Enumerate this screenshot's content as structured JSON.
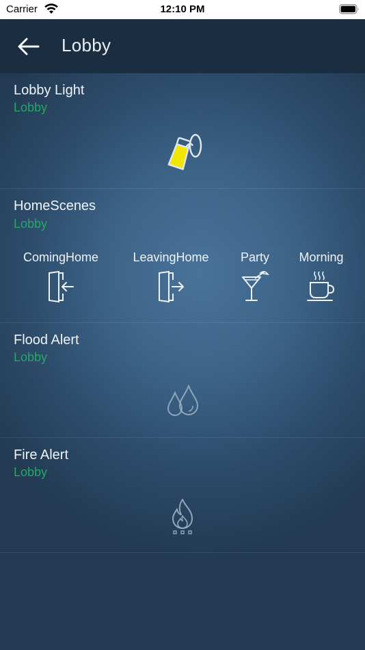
{
  "status_bar": {
    "carrier": "Carrier",
    "time": "12:10 PM"
  },
  "nav": {
    "title": "Lobby",
    "back_icon": "arrow-left-icon"
  },
  "cards": [
    {
      "title": "Lobby Light",
      "room": "Lobby",
      "icon": "wall-lamp-icon",
      "icon_color": "#f2e600"
    },
    {
      "title": "HomeScenes",
      "room": "Lobby",
      "scenes": [
        {
          "label": "ComingHome",
          "icon": "door-enter-icon"
        },
        {
          "label": "LeavingHome",
          "icon": "door-exit-icon"
        },
        {
          "label": "Party",
          "icon": "cocktail-icon"
        },
        {
          "label": "Morning",
          "icon": "coffee-cup-icon"
        }
      ]
    },
    {
      "title": "Flood Alert",
      "room": "Lobby",
      "icon": "water-drops-icon"
    },
    {
      "title": "Fire Alert",
      "room": "Lobby",
      "icon": "flame-icon"
    }
  ],
  "colors": {
    "room_label": "#27a56a",
    "navbar": "#1b2d40",
    "lamp_glow": "#f2e600"
  }
}
